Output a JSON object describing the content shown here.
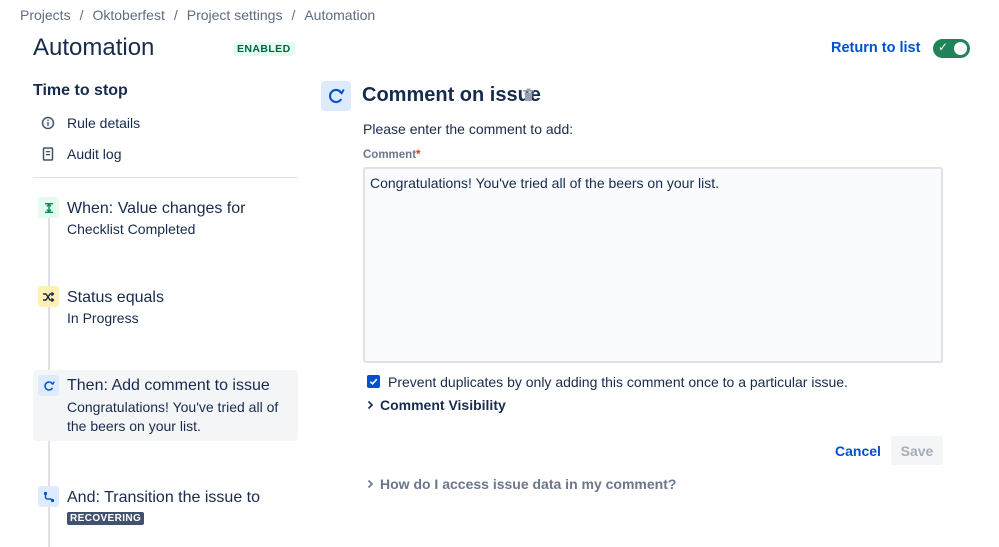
{
  "breadcrumb": {
    "items": [
      "Projects",
      "Oktoberfest",
      "Project settings",
      "Automation"
    ],
    "separator": "/"
  },
  "header": {
    "title": "Automation",
    "status": "ENABLED",
    "return_label": "Return to list",
    "rule_enabled": true
  },
  "sidebar": {
    "rule_name": "Time to stop",
    "links": [
      {
        "label": "Rule details",
        "icon": "info-icon"
      },
      {
        "label": "Audit log",
        "icon": "document-icon"
      }
    ]
  },
  "steps": [
    {
      "title": "When: Value changes for",
      "subtitle": "Checklist Completed",
      "icon": "trigger-icon",
      "icon_bg": "#e3fcef",
      "icon_color": "#00875a"
    },
    {
      "title": "Status equals",
      "subtitle": "In Progress",
      "icon": "shuffle-icon",
      "icon_bg": "#fff0b3",
      "icon_color": "#172b4d"
    },
    {
      "title": "Then: Add comment to issue",
      "subtitle": "Congratulations! You've tried all of the beers on your list.",
      "icon": "comment-action-icon",
      "icon_bg": "#deebff",
      "icon_color": "#0052cc",
      "selected": true
    },
    {
      "title": "And: Transition the issue to",
      "badge": "RECOVERING",
      "icon": "transition-icon",
      "icon_bg": "#deebff",
      "icon_color": "#0052cc"
    }
  ],
  "panel": {
    "title": "Comment on issue",
    "instruction": "Please enter the comment to add:",
    "field_label": "Comment",
    "required_marker": "*",
    "comment_value": "Congratulations! You've tried all of the beers on your list.",
    "prevent_duplicates_label": "Prevent duplicates by only adding this comment once to a particular issue.",
    "prevent_duplicates_checked": true,
    "visibility_label": "Comment Visibility",
    "cancel_label": "Cancel",
    "save_label": "Save",
    "help_label": "How do I access issue data in my comment?"
  },
  "colors": {
    "accent": "#0052cc",
    "toggle_on": "#1f845a",
    "lozenge_green": "#006644",
    "badge_dark": "#42526e"
  }
}
